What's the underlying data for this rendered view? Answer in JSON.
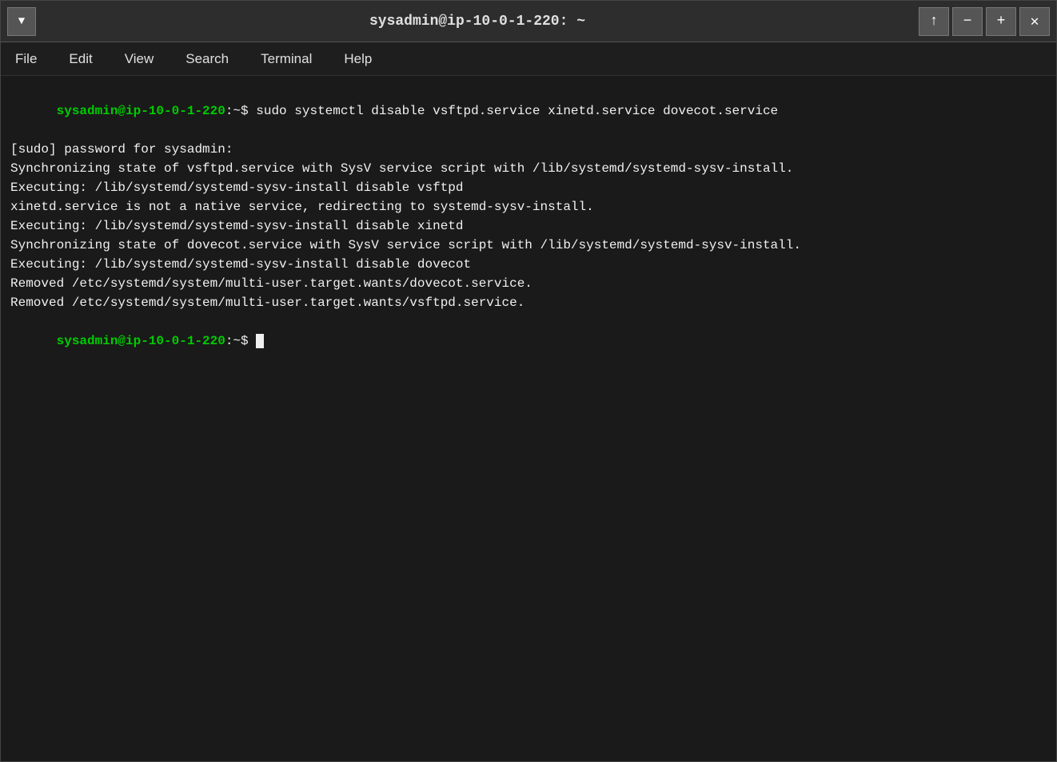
{
  "titlebar": {
    "title": "sysadmin@ip-10-0-1-220: ~",
    "menu_btn_label": "▼",
    "btn_up": "↑",
    "btn_minimize": "−",
    "btn_maximize": "+",
    "btn_close": "✕"
  },
  "menubar": {
    "items": [
      "File",
      "Edit",
      "View",
      "Search",
      "Terminal",
      "Help"
    ]
  },
  "terminal": {
    "prompt1": "sysadmin@ip-10-0-1-220",
    "prompt1_suffix": ":~$ ",
    "command1": "sudo systemctl disable vsftpd.service xinetd.service dovecot.service",
    "line2": "[sudo] password for sysadmin:",
    "line3": "Synchronizing state of vsftpd.service with SysV service script with /lib/systemd/systemd-sysv-install.",
    "line4": "Executing: /lib/systemd/systemd-sysv-install disable vsftpd",
    "line5": "xinetd.service is not a native service, redirecting to systemd-sysv-install.",
    "line6": "Executing: /lib/systemd/systemd-sysv-install disable xinetd",
    "line7": "Synchronizing state of dovecot.service with SysV service script with /lib/systemd/systemd-sysv-install.",
    "line8": "Executing: /lib/systemd/systemd-sysv-install disable dovecot",
    "line9": "Removed /etc/systemd/system/multi-user.target.wants/dovecot.service.",
    "line10": "Removed /etc/systemd/system/multi-user.target.wants/vsftpd.service.",
    "prompt2": "sysadmin@ip-10-0-1-220",
    "prompt2_suffix": ":~$ "
  }
}
